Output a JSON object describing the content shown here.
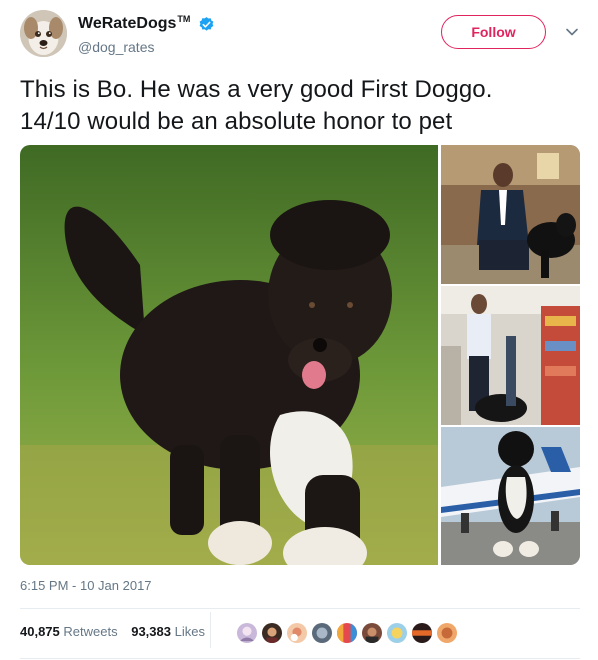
{
  "author": {
    "display_name": "WeRateDogs",
    "trademark": "TM",
    "handle": "@dog_rates",
    "avatar_icon": "dog-face-avatar",
    "verified_icon": "verified-badge-icon"
  },
  "actions": {
    "follow_label": "Follow",
    "menu_icon": "chevron-down-icon"
  },
  "tweet": {
    "text_line1": "This is Bo. He was a very good First Doggo.",
    "text_line2": "14/10 would be an absolute honor to pet",
    "timestamp": "6:15 PM - 10 Jan 2017"
  },
  "stats": {
    "retweets_count": "40,875",
    "retweets_label": "Retweets",
    "likes_count": "93,383",
    "likes_label": "Likes"
  },
  "colors": {
    "follow_accent": "#e0245e",
    "verified_blue": "#1da1f2",
    "muted_text": "#657786",
    "divider": "#e6ecf0"
  }
}
